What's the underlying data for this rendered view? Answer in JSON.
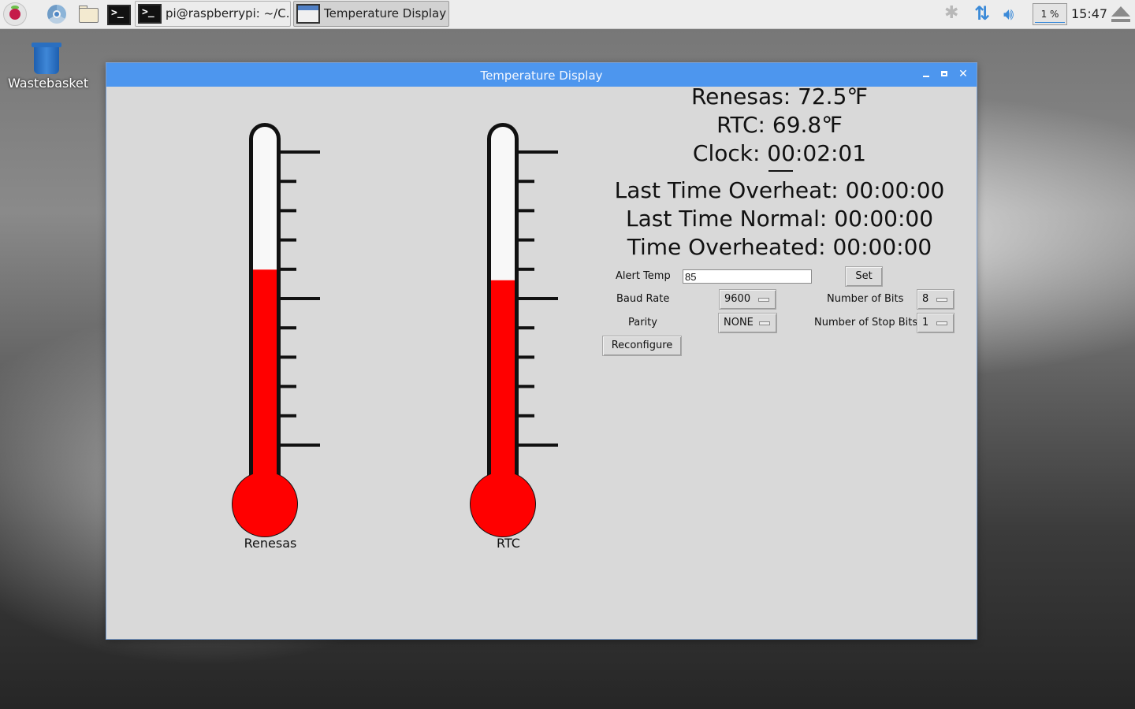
{
  "taskbar": {
    "terminal_task_label": "pi@raspberrypi: ~/C...",
    "app_task_label": "Temperature Display",
    "cpu_usage_text": "1 %",
    "cpu_usage_percent": 1,
    "clock": "15:47"
  },
  "desktop": {
    "wastebasket_label": "Wastebasket"
  },
  "window": {
    "title": "Temperature Display"
  },
  "thermometers": [
    {
      "label": "Renesas",
      "fill_fraction": 0.595,
      "fill_color": "#ff0000"
    },
    {
      "label": "RTC",
      "fill_fraction": 0.565,
      "fill_color": "#ff0000"
    }
  ],
  "readings": {
    "renesas": "Renesas: 72.5℉",
    "rtc": "RTC: 69.8℉",
    "clock": "Clock: 00:02:01",
    "last_overheat": "Last Time Overheat: 00:00:00",
    "last_normal": "Last Time Normal: 00:00:00",
    "time_overheated": "Time Overheated: 00:00:00"
  },
  "form": {
    "alert_temp_label": "Alert Temp",
    "alert_temp_value": "85",
    "set_button": "Set",
    "baud_rate_label": "Baud Rate",
    "baud_rate_value": "9600",
    "number_of_bits_label": "Number of Bits",
    "number_of_bits_value": "8",
    "parity_label": "Parity",
    "parity_value": "NONE",
    "stop_bits_label": "Number of Stop Bits",
    "stop_bits_value": "1",
    "reconfigure_button": "Reconfigure"
  }
}
